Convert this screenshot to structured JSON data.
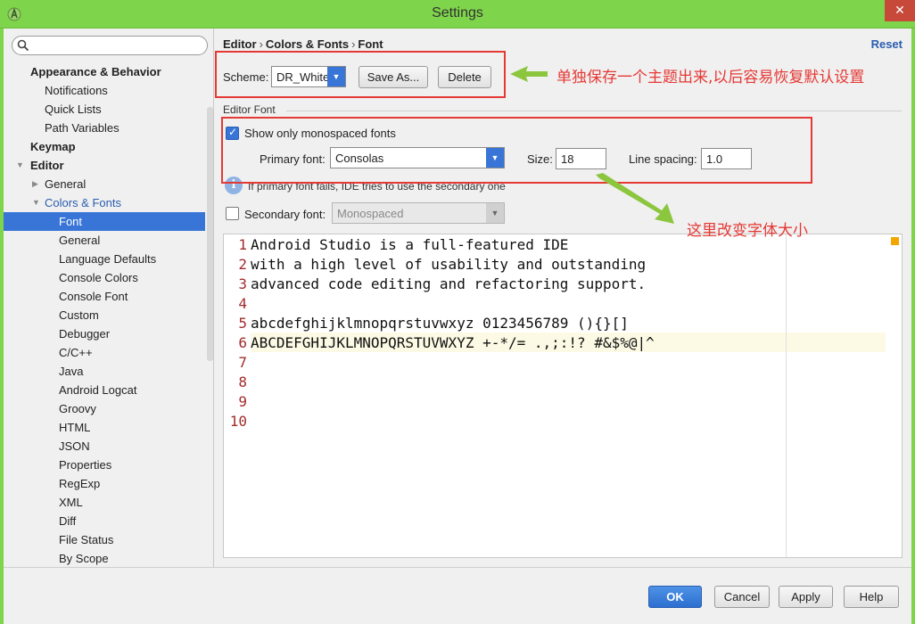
{
  "window": {
    "title": "Settings",
    "close_glyph": "✕"
  },
  "sidebar": {
    "search_placeholder": "",
    "items": [
      {
        "label": "Appearance & Behavior"
      },
      {
        "label": "Notifications"
      },
      {
        "label": "Quick Lists"
      },
      {
        "label": "Path Variables"
      },
      {
        "label": "Keymap"
      },
      {
        "label": "Editor"
      },
      {
        "label": "General"
      },
      {
        "label": "Colors & Fonts"
      },
      {
        "label": "Font"
      },
      {
        "label": "General"
      },
      {
        "label": "Language Defaults"
      },
      {
        "label": "Console Colors"
      },
      {
        "label": "Console Font"
      },
      {
        "label": "Custom"
      },
      {
        "label": "Debugger"
      },
      {
        "label": "C/C++"
      },
      {
        "label": "Java"
      },
      {
        "label": "Android Logcat"
      },
      {
        "label": "Groovy"
      },
      {
        "label": "HTML"
      },
      {
        "label": "JSON"
      },
      {
        "label": "Properties"
      },
      {
        "label": "RegExp"
      },
      {
        "label": "XML"
      },
      {
        "label": "Diff"
      },
      {
        "label": "File Status"
      },
      {
        "label": "By Scope"
      }
    ]
  },
  "breadcrumb": {
    "part1": "Editor",
    "part2": "Colors & Fonts",
    "part3": "Font",
    "separator": "›"
  },
  "reset_label": "Reset",
  "scheme": {
    "label": "Scheme:",
    "value": "DR_White",
    "save_as_label": "Save As...",
    "delete_label": "Delete"
  },
  "editor_font": {
    "group_title": "Editor Font",
    "show_mono_label": "Show only monospaced fonts",
    "show_mono_checked": true,
    "primary_font_label": "Primary font:",
    "primary_font_value": "Consolas",
    "size_label": "Size:",
    "size_value": "18",
    "line_spacing_label": "Line spacing:",
    "line_spacing_value": "1.0",
    "info_text": "If primary font fails, IDE tries to use the secondary one",
    "secondary_font_label": "Secondary font:",
    "secondary_font_checked": false,
    "secondary_font_value": "Monospaced"
  },
  "preview": {
    "line_numbers": [
      "1",
      "2",
      "3",
      "4",
      "5",
      "6",
      "7",
      "8",
      "9",
      "10"
    ],
    "lines": [
      "Android Studio is a full-featured IDE",
      "with a high level of usability and outstanding",
      "advanced code editing and refactoring support.",
      "",
      "abcdefghijklmnopqrstuvwxyz 0123456789 (){}[]",
      "ABCDEFGHIJKLMNOPQRSTUVWXYZ +-*/= .,;:!? #&$%@|^"
    ]
  },
  "buttons": {
    "ok": "OK",
    "cancel": "Cancel",
    "apply": "Apply",
    "help": "Help"
  },
  "annotations": {
    "scheme_note": "单独保存一个主题出来,以后容易恢复默认设置",
    "size_note": "这里改变字体大小"
  },
  "colors": {
    "title_bar": "#7ed44a",
    "selection": "#3875d7",
    "annotation": "#e53935",
    "arrow": "#8cc63f"
  }
}
